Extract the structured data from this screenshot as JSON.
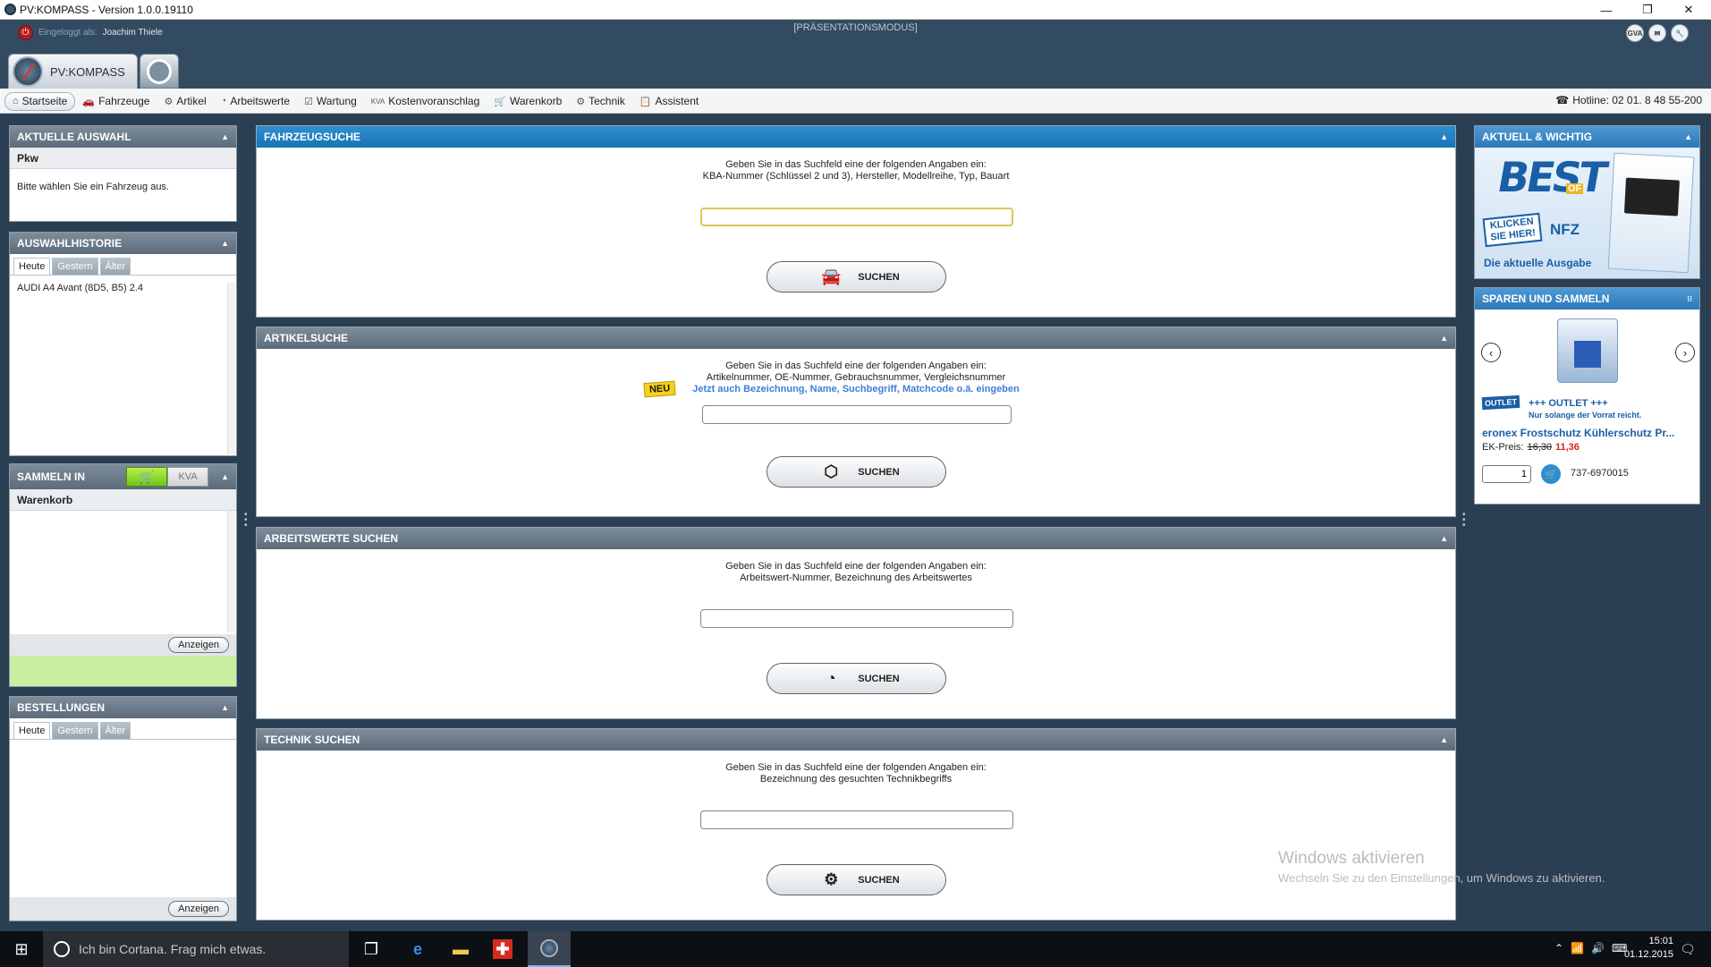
{
  "window": {
    "title": "PV:KOMPASS - Version 1.0.0.19110",
    "minimize": "—",
    "restore": "❐",
    "close": "✕"
  },
  "topbar": {
    "logged_in_label": "Eingeloggt als:",
    "user": "Joachim Thiele",
    "mode": "[PRÄSENTATIONSMODUS]",
    "icons": [
      "gva-icon",
      "mail-icon",
      "wrench-icon"
    ],
    "gva_label": "GVA",
    "app_tab_label": "PV:KOMPASS"
  },
  "nav": {
    "items": [
      {
        "label": "Startseite",
        "icon": "⌂"
      },
      {
        "label": "Fahrzeuge",
        "icon": "🚗"
      },
      {
        "label": "Artikel",
        "icon": "⚙"
      },
      {
        "label": "Arbeitswerte",
        "icon": "◔"
      },
      {
        "label": "Wartung",
        "icon": "☑"
      },
      {
        "label": "Kostenvoranschlag",
        "icon": "KVA"
      },
      {
        "label": "Warenkorb",
        "icon": "🛒"
      },
      {
        "label": "Technik",
        "icon": "⚙"
      },
      {
        "label": "Assistent",
        "icon": "📋"
      }
    ],
    "hotline": "Hotline: 02 01. 8 48 55-200"
  },
  "left": {
    "aktuelle_auswahl": {
      "title": "AKTUELLE AUSWAHL",
      "sub": "Pkw",
      "text": "Bitte wählen Sie ein Fahrzeug aus."
    },
    "historie": {
      "title": "AUSWAHLHISTORIE",
      "tabs": [
        "Heute",
        "Gestern",
        "Älter"
      ],
      "items": [
        "AUDI A4 Avant (8D5, B5) 2.4"
      ]
    },
    "sammeln": {
      "title": "SAMMELN IN",
      "kva": "KVA",
      "sub": "Warenkorb",
      "button": "Anzeigen"
    },
    "bestellungen": {
      "title": "BESTELLUNGEN",
      "tabs": [
        "Heute",
        "Gestern",
        "Älter"
      ],
      "button": "Anzeigen"
    }
  },
  "center": {
    "fahrzeugsuche": {
      "title": "FAHRZEUGSUCHE",
      "line1": "Geben Sie in das Suchfeld eine der folgenden Angaben ein:",
      "line2": "KBA-Nummer (Schlüssel 2 und 3), Hersteller, Modellreihe, Typ, Bauart",
      "value": "",
      "button": "SUCHEN"
    },
    "artikelsuche": {
      "title": "ARTIKELSUCHE",
      "line1": "Geben Sie in das Suchfeld eine der folgenden Angaben ein:",
      "line2": "Artikelnummer, OE-Nummer, Gebrauchsnummer, Vergleichsnummer",
      "line3": "Jetzt auch Bezeichnung, Name, Suchbegriff, Matchcode o.ä. eingeben",
      "badge": "NEU",
      "value": "",
      "button": "SUCHEN"
    },
    "arbeitswerte": {
      "title": "ARBEITSWERTE SUCHEN",
      "line1": "Geben Sie in das Suchfeld eine der folgenden Angaben ein:",
      "line2": "Arbeitswert-Nummer, Bezeichnung des Arbeitswertes",
      "value": "",
      "button": "SUCHEN"
    },
    "technik": {
      "title": "TECHNIK SUCHEN",
      "line1": "Geben Sie in das Suchfeld eine der folgenden Angaben ein:",
      "line2": "Bezeichnung des gesuchten Technikbegriffs",
      "value": "",
      "button": "SUCHEN"
    }
  },
  "right": {
    "aktuell": {
      "title": "AKTUELL & WICHTIG",
      "best": "BEST",
      "of": "OF",
      "klicken": "KLICKEN SIE HIER!",
      "nfz": "NFZ",
      "caption": "Die aktuelle Ausgabe"
    },
    "sparen": {
      "title": "SPAREN UND SAMMELN",
      "outlet_logo": "OUTLET",
      "outlet": "+++ OUTLET +++",
      "outlet_sub": "Nur solange der Vorrat reicht.",
      "product": "eronex Frostschutz Kühlerschutz Pr...",
      "price_label": "EK-Preis:",
      "price_old": "16,30",
      "price_new": "11,36",
      "qty": "1",
      "article_no": "737-6970015"
    }
  },
  "watermark": {
    "line1": "Windows aktivieren",
    "line2": "Wechseln Sie zu den Einstellungen, um Windows zu aktivieren."
  },
  "taskbar": {
    "search": "Ich bin Cortana. Frag mich etwas.",
    "time": "15:01",
    "date": "01.12.2015"
  }
}
